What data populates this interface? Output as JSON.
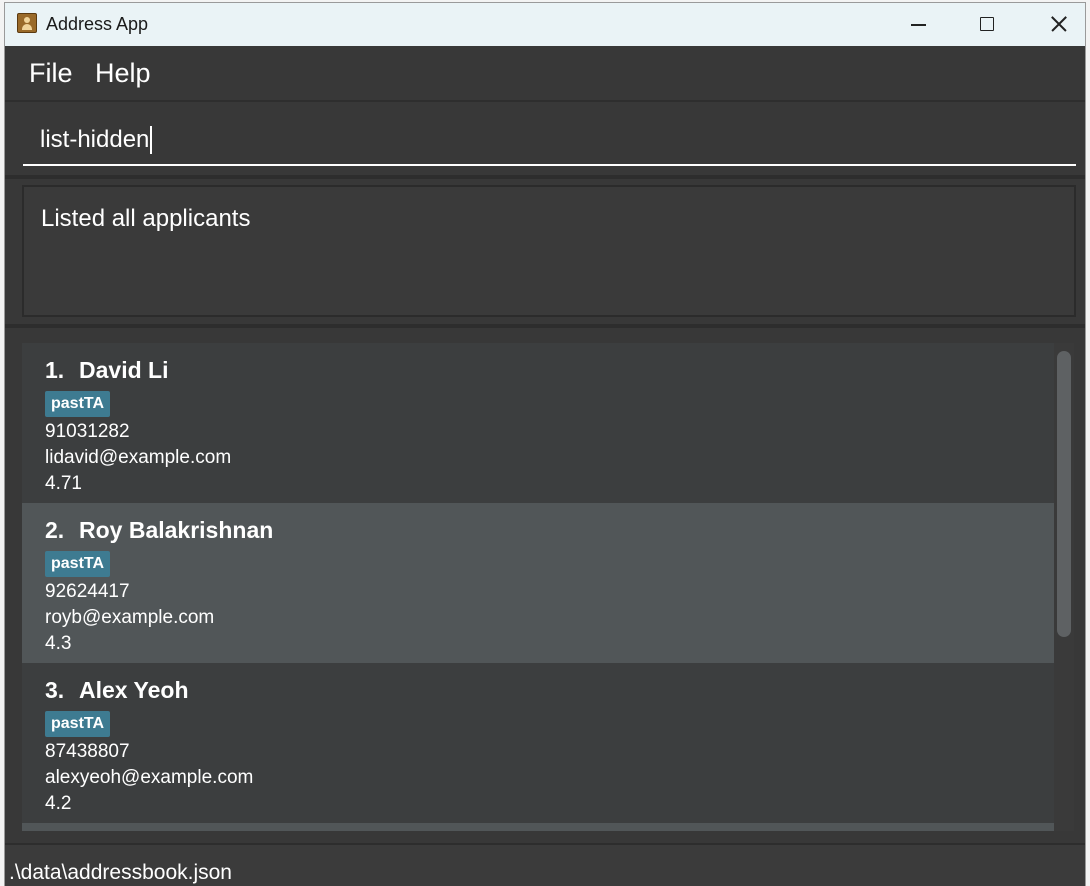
{
  "window": {
    "title": "Address App"
  },
  "menu": {
    "items": [
      "File",
      "Help"
    ]
  },
  "command": {
    "value": "list-hidden"
  },
  "result": {
    "message": "Listed all applicants"
  },
  "applicants": [
    {
      "index": "1.",
      "name": "David Li",
      "tag": "pastTA",
      "phone": "91031282",
      "email": "lidavid@example.com",
      "gpa": "4.71",
      "selected": false
    },
    {
      "index": "2.",
      "name": "Roy Balakrishnan",
      "tag": "pastTA",
      "phone": "92624417",
      "email": "royb@example.com",
      "gpa": "4.3",
      "selected": true
    },
    {
      "index": "3.",
      "name": "Alex Yeoh",
      "tag": "pastTA",
      "phone": "87438807",
      "email": "alexyeoh@example.com",
      "gpa": "4.2",
      "selected": false
    }
  ],
  "status": {
    "file_path": ".\\data\\addressbook.json"
  },
  "colors": {
    "background": "#383838",
    "selected_card": "#515658",
    "card": "#3c3e3f",
    "tag": "#3e7b91",
    "titlebar": "#eaf3f6"
  }
}
